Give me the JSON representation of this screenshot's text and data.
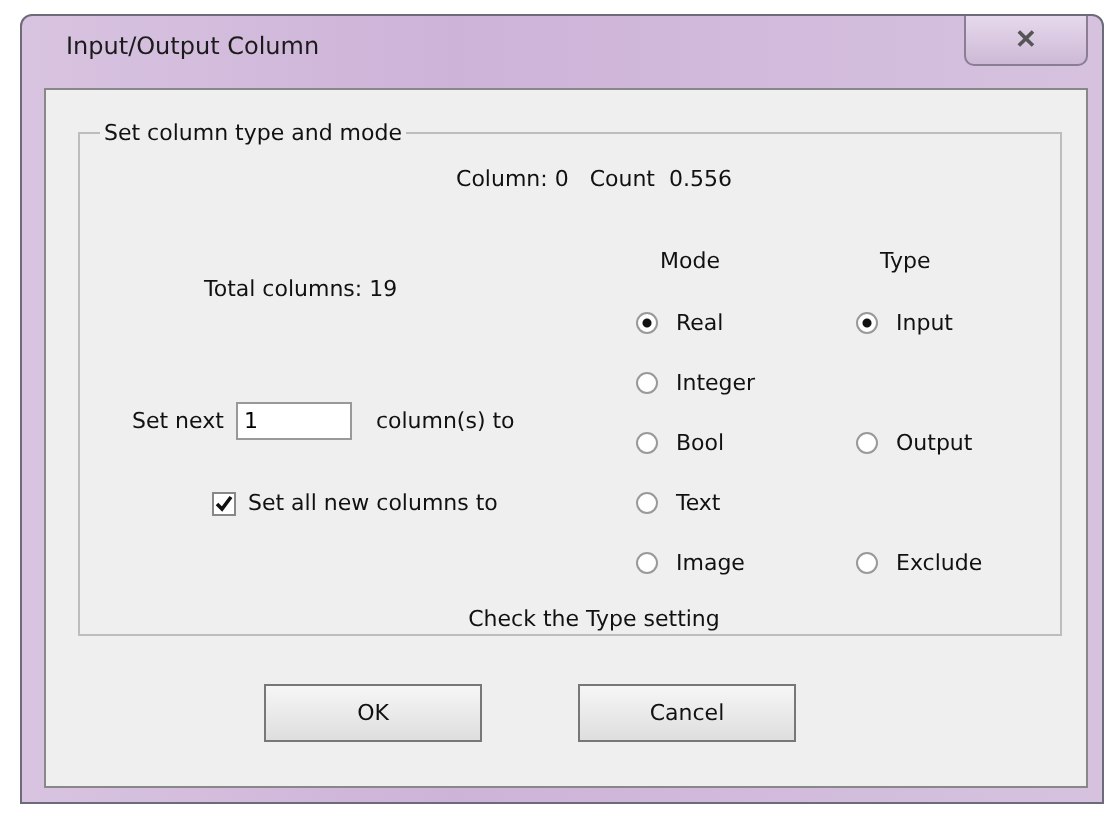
{
  "window": {
    "title": "Input/Output Column",
    "close": "✕"
  },
  "group": {
    "legend": "Set column type and mode",
    "column_info": "Column: 0   Count  0.556",
    "total_columns": "Total columns: 19",
    "set_next": {
      "label": "Set next",
      "value": "1",
      "suffix": "column(s) to"
    },
    "set_all": {
      "label": "Set all new columns to",
      "checked": true
    },
    "mode": {
      "heading": "Mode",
      "options": [
        {
          "label": "Real",
          "selected": true
        },
        {
          "label": "Integer",
          "selected": false
        },
        {
          "label": "Bool",
          "selected": false
        },
        {
          "label": "Text",
          "selected": false
        },
        {
          "label": "Image",
          "selected": false
        }
      ]
    },
    "type": {
      "heading": "Type",
      "options": [
        {
          "label": "Input",
          "selected": true
        },
        {
          "label": "Output",
          "selected": false
        },
        {
          "label": "Exclude",
          "selected": false
        }
      ]
    },
    "message": "Check the Type setting"
  },
  "buttons": [
    "OK",
    "Cancel"
  ]
}
